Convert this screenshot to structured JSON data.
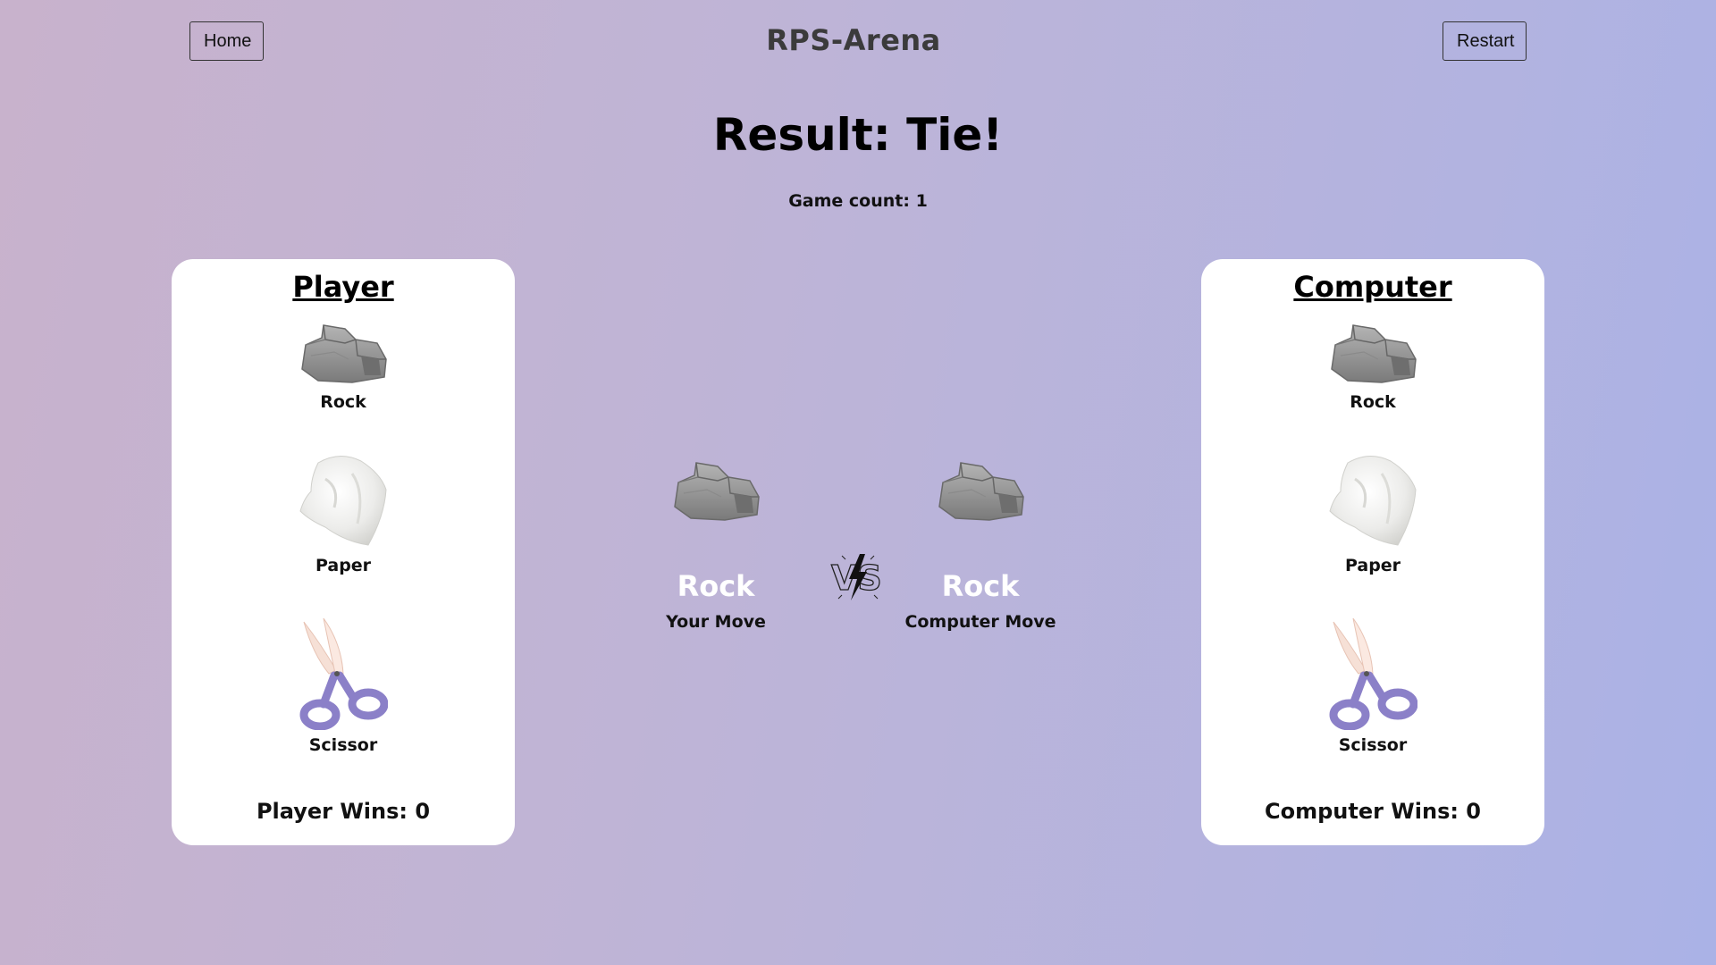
{
  "header": {
    "home_label": "Home",
    "title": "RPS-Arena",
    "restart_label": "Restart"
  },
  "result_text": "Result: Tie!",
  "game_count_text": "Game count: 1",
  "player": {
    "title": "Player",
    "choices": [
      {
        "label": "Rock",
        "icon": "rock-icon"
      },
      {
        "label": "Paper",
        "icon": "paper-icon"
      },
      {
        "label": "Scissor",
        "icon": "scissor-icon"
      }
    ],
    "wins_text": "Player Wins: 0"
  },
  "computer": {
    "title": "Computer",
    "choices": [
      {
        "label": "Rock",
        "icon": "rock-icon"
      },
      {
        "label": "Paper",
        "icon": "paper-icon"
      },
      {
        "label": "Scissor",
        "icon": "scissor-icon"
      }
    ],
    "wins_text": "Computer Wins: 0"
  },
  "battle": {
    "your_move": {
      "name": "Rock",
      "caption": "Your Move",
      "icon": "rock-icon"
    },
    "computer_move": {
      "name": "Rock",
      "caption": "Computer Move",
      "icon": "rock-icon"
    },
    "vs_icon": "vs-lightning-icon"
  },
  "colors": {
    "bg_start": "#c8b2cc",
    "bg_end": "#aab2e6",
    "scissor_handle": "#8b80c8",
    "scissor_blade": "#f4d9cf",
    "rock": "#8e8e8e"
  }
}
